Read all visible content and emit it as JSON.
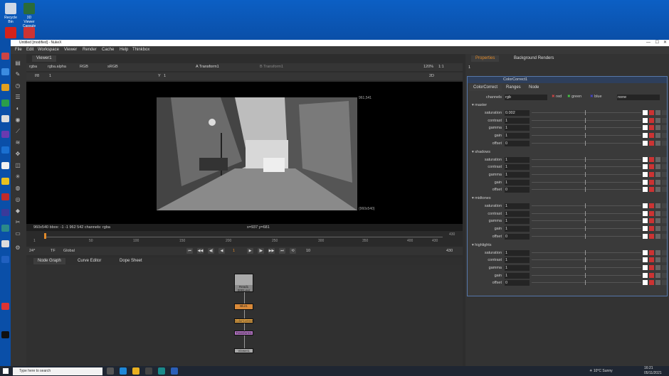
{
  "window": {
    "title": "Untitled [modified] - NukeX",
    "controls": [
      "—",
      "☐",
      "✕"
    ]
  },
  "desktop": {
    "icons": [
      "Recycle Bin",
      "3D Viewer Capsule",
      "Acrobat Reader",
      "Crashreporter"
    ]
  },
  "menu": [
    "File",
    "Edit",
    "Workspace",
    "Viewer",
    "Render",
    "Cache",
    "Help",
    "Thinkbox"
  ],
  "viewer": {
    "tab": "Viewer1",
    "channels": "rgba",
    "alpha": "rgba.alpha",
    "rgb": "RGB",
    "lut": "sRGB",
    "input_a": "Transform1",
    "input_b": "Transform1",
    "zoom": "120%",
    "ratio": "1:1",
    "mode": "2D",
    "frame_label": "f/8",
    "frame_value": "1",
    "y_label": "Y",
    "y_value": "1",
    "corner_top": "961,541",
    "corner_bottom": "(960x540)",
    "info_left": "960x540  bbox: -1 -1 962 542 channels: rgba",
    "info_coords": "x=937 y=681"
  },
  "timeline": {
    "ticks": [
      "1",
      "50",
      "100",
      "150",
      "200",
      "250",
      "300",
      "350",
      "400",
      "430"
    ],
    "start": "1",
    "end": "430",
    "fps": "24*",
    "tf": "TF",
    "scope": "Global",
    "current_frame": "1",
    "step": "10",
    "end_frame": "430"
  },
  "node_tabs": [
    "Node Graph",
    "Curve Editor",
    "Dope Sheet"
  ],
  "nodes": {
    "read": "Read1",
    "read_sub": "0001.exr",
    "blur": "Blur1",
    "colorcorrect": "ColorCorrect1",
    "transform": "Transform1",
    "viewer": "Viewer1"
  },
  "properties": {
    "tabs": [
      "Properties",
      "Background Renders"
    ],
    "node_count": "1",
    "node_name": "ColorCorrect1",
    "subtabs": [
      "ColorCorrect",
      "Ranges",
      "Node"
    ],
    "channels_label": "channels",
    "channels_value": "rgb",
    "red": "red",
    "green": "green",
    "blue": "blue",
    "mask_value": "none",
    "sections": [
      {
        "name": "master",
        "rows": [
          {
            "label": "saturation",
            "value": "0.002"
          },
          {
            "label": "contrast",
            "value": "1"
          },
          {
            "label": "gamma",
            "value": "1"
          },
          {
            "label": "gain",
            "value": "1"
          },
          {
            "label": "offset",
            "value": "0"
          }
        ]
      },
      {
        "name": "shadows",
        "rows": [
          {
            "label": "saturation",
            "value": "1"
          },
          {
            "label": "contrast",
            "value": "1"
          },
          {
            "label": "gamma",
            "value": "1"
          },
          {
            "label": "gain",
            "value": "1"
          },
          {
            "label": "offset",
            "value": "0"
          }
        ]
      },
      {
        "name": "midtones",
        "rows": [
          {
            "label": "saturation",
            "value": "1"
          },
          {
            "label": "contrast",
            "value": "1"
          },
          {
            "label": "gamma",
            "value": "1"
          },
          {
            "label": "gain",
            "value": "1"
          },
          {
            "label": "offset",
            "value": "0"
          }
        ]
      },
      {
        "name": "highlights",
        "rows": [
          {
            "label": "saturation",
            "value": "1"
          },
          {
            "label": "contrast",
            "value": "1"
          },
          {
            "label": "gamma",
            "value": "1"
          },
          {
            "label": "gain",
            "value": "1"
          },
          {
            "label": "offset",
            "value": "0"
          }
        ]
      }
    ]
  },
  "taskbar": {
    "search_placeholder": "Type here to search",
    "weather": "10°C  Sunny",
    "time": "16:21",
    "date": "05/11/2021"
  },
  "colors": {
    "accent_orange": "#e08a2a",
    "properties_border": "#5577aa",
    "desktop_blue": "#0a4fa8"
  }
}
